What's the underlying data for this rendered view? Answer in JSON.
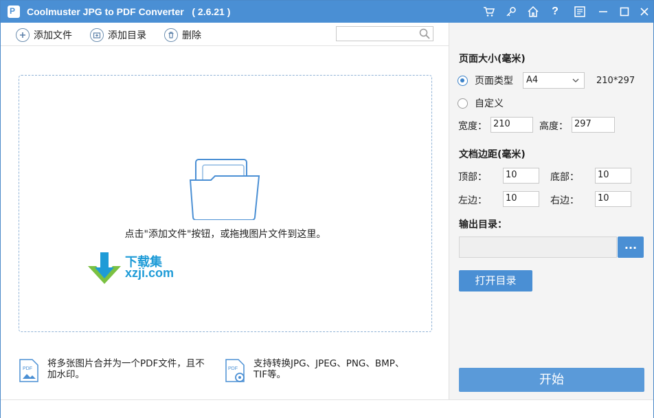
{
  "window": {
    "title": "Coolmuster JPG to PDF Converter   ( 2.6.21 )",
    "logo_letter": "P",
    "accent_color": "#4a8fd4"
  },
  "titlebar_icons": [
    "cart-icon",
    "key-icon",
    "home-icon",
    "help-icon",
    "feedback-icon",
    "minimize-icon",
    "maximize-icon",
    "close-icon"
  ],
  "toolbar": {
    "add_file_label": "添加文件",
    "add_folder_label": "添加目录",
    "delete_label": "删除",
    "search_placeholder": ""
  },
  "main": {
    "hint": "点击\"添加文件\"按钮，或拖拽图片文件到这里。",
    "watermark_text": "下载集",
    "watermark_sub": "xzji.com",
    "features": [
      {
        "icon": "pdf-merge-icon",
        "line1": "将多张图片合并为一个PDF文件，且不",
        "line2": "加水印。"
      },
      {
        "icon": "pdf-convert-icon",
        "line1": "支持转换JPG、JPEG、PNG、BMP、",
        "line2": "TIF等。"
      }
    ]
  },
  "settings": {
    "page_size_title": "页面大小(毫米)",
    "page_type_label": "页面类型",
    "page_type_value": "A4",
    "page_type_dims": "210*297",
    "custom_label": "自定义",
    "width_label": "宽度：",
    "width_value": "210",
    "height_label": "高度：",
    "height_value": "297",
    "margin_title": "文档边距(毫米)",
    "top_label": "顶部：",
    "top_value": "10",
    "bottom_label": "底部：",
    "bottom_value": "10",
    "left_label": "左边：",
    "left_value": "10",
    "right_label": "右边：",
    "right_value": "10",
    "output_title": "输出目录：",
    "output_value": "",
    "browse_label": "...",
    "open_dir_label": "打开目录",
    "start_label": "开始"
  }
}
